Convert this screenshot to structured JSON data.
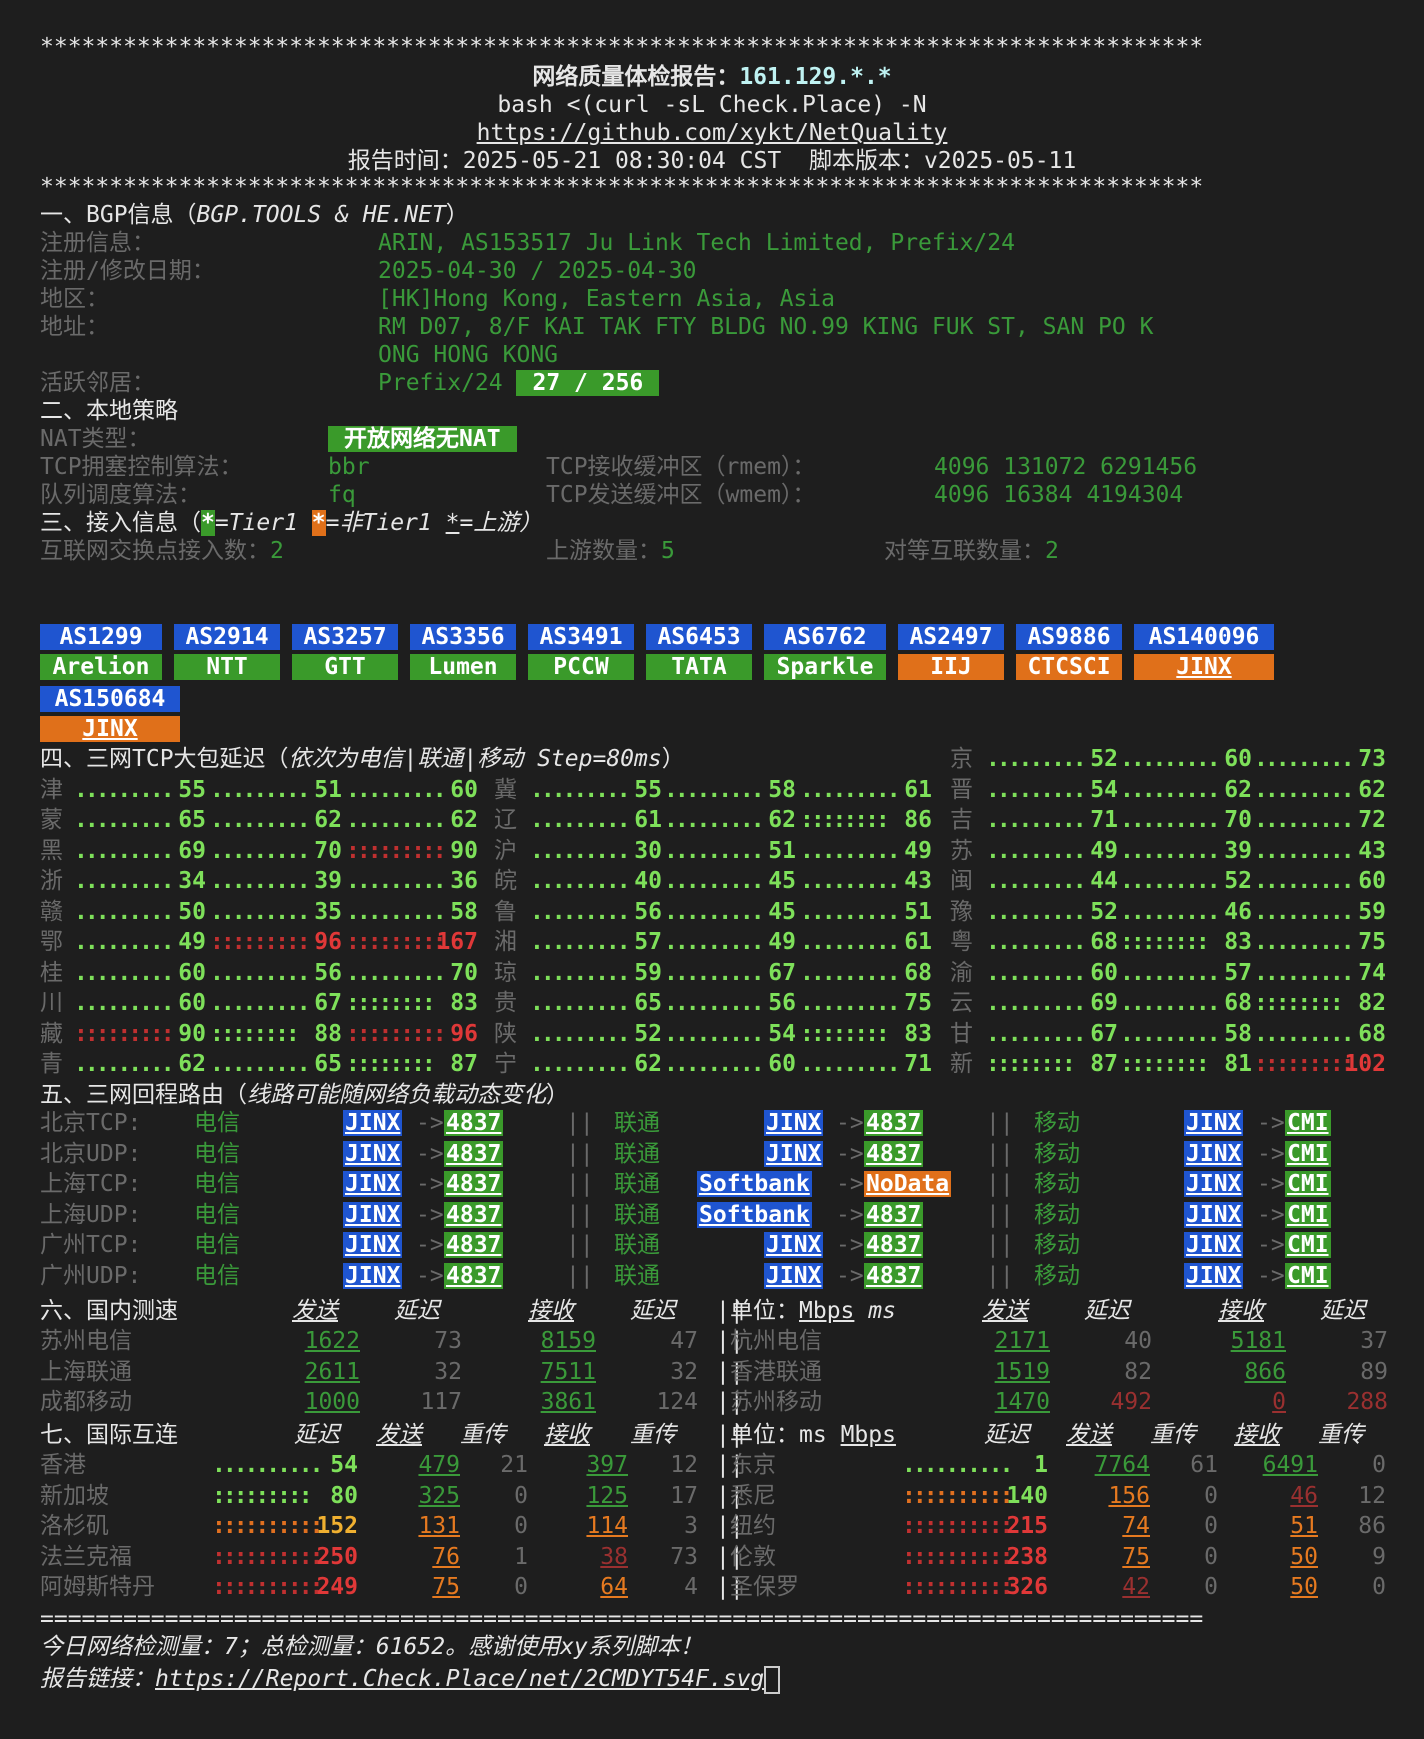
{
  "header": {
    "stars": "************************************************************************************",
    "title_cn": "网络质量体检报告：",
    "ip": "161.129.*.*",
    "cmd": "bash <(curl -sL Check.Place) -N",
    "repo": "https://github.com/xykt/NetQuality",
    "time_label": "报告时间：",
    "time": "2025-05-21 08:30:04 CST",
    "ver_label": "脚本版本：",
    "ver": "v2025-05-11"
  },
  "bgp": {
    "heading": "一、BGP信息（",
    "heading_src": "BGP.TOOLS & HE.NET",
    "heading_end": "）",
    "reg_label": "注册信息：",
    "reg": "ARIN, AS153517 Ju Link Tech Limited, Prefix/24",
    "date_label": "注册/修改日期：",
    "date": "2025-04-30 / 2025-04-30",
    "region_label": "地区：",
    "region": "[HK]Hong Kong, Eastern Asia, Asia",
    "addr_label": "地址：",
    "addr1": "RM D07, 8/F KAI TAK FTY BLDG NO.99 KING FUK ST, SAN PO K",
    "addr2": "ONG HONG KONG",
    "neigh_label": "活跃邻居：",
    "neigh_prefix": "Prefix/24",
    "neigh_val": "27 / 256"
  },
  "policy": {
    "heading": "二、本地策略",
    "nat_label": "NAT类型：",
    "nat": "开放网络无NAT",
    "cc_label": "TCP拥塞控制算法：",
    "cc": "bbr",
    "rmem_label": "TCP接收缓冲区（rmem）：",
    "rmem": "4096 131072 6291456",
    "q_label": "队列调度算法：",
    "q": "fq",
    "wmem_label": "TCP发送缓冲区（wmem）：",
    "wmem": "4096 16384 4194304"
  },
  "access": {
    "heading": "三、接入信息（",
    "t1": "*",
    "t1_txt": "=Tier1 ",
    "t2": "*",
    "t2_txt": "=非Tier1 ",
    "t3": "*",
    "t3_txt": "=上游）",
    "ix_label": "互联网交换点接入数：",
    "ix": "2",
    "up_label": "上游数量：",
    "up": "5",
    "peer_label": "对等互联数量：",
    "peer": "2",
    "asns": [
      {
        "as": "AS1299",
        "name": "Arelion"
      },
      {
        "as": "AS2914",
        "name": "NTT"
      },
      {
        "as": "AS3257",
        "name": "GTT"
      },
      {
        "as": "AS3356",
        "name": "Lumen"
      },
      {
        "as": "AS3491",
        "name": "PCCW"
      },
      {
        "as": "AS6453",
        "name": "TATA"
      },
      {
        "as": "AS6762",
        "name": "Sparkle"
      },
      {
        "as": "AS2497",
        "name": "IIJ"
      },
      {
        "as": "AS9886",
        "name": "CTCSCI"
      },
      {
        "as": "AS140096",
        "name": "JINX"
      },
      {
        "as": "AS150684",
        "name": "JINX"
      }
    ]
  },
  "latency": {
    "heading": "四、三网TCP大包延迟（",
    "heading_i": "依次为电信|联通|移动 Step=80ms",
    "heading_end": "）",
    "rows": [
      [
        "",
        "",
        "",
        "",
        "",
        "",
        "",
        "",
        "",
        "京",
        "52",
        "60",
        "73"
      ],
      [
        "津",
        "55",
        "51",
        "60",
        "冀",
        "55",
        "58",
        "61",
        "",
        "晋",
        "54",
        "62",
        "62"
      ],
      [
        "蒙",
        "65",
        "62",
        "62",
        "辽",
        "61",
        "62",
        "86",
        "",
        "吉",
        "71",
        "70",
        "72"
      ],
      [
        "黑",
        "69",
        "70",
        "90",
        "沪",
        "30",
        "51",
        "49",
        "",
        "苏",
        "49",
        "39",
        "43"
      ],
      [
        "浙",
        "34",
        "39",
        "36",
        "皖",
        "40",
        "45",
        "43",
        "",
        "闽",
        "44",
        "52",
        "60"
      ],
      [
        "赣",
        "50",
        "35",
        "58",
        "鲁",
        "56",
        "45",
        "51",
        "",
        "豫",
        "52",
        "46",
        "59"
      ],
      [
        "鄂",
        "49",
        "96",
        "167",
        "湘",
        "57",
        "49",
        "61",
        "",
        "粤",
        "68",
        "83",
        "75"
      ],
      [
        "桂",
        "60",
        "56",
        "70",
        "琼",
        "59",
        "67",
        "68",
        "",
        "渝",
        "60",
        "57",
        "74"
      ],
      [
        "川",
        "60",
        "67",
        "83",
        "贵",
        "65",
        "56",
        "75",
        "",
        "云",
        "69",
        "68",
        "82"
      ],
      [
        "藏",
        "90",
        "88",
        "96",
        "陕",
        "52",
        "54",
        "83",
        "",
        "甘",
        "67",
        "58",
        "68"
      ],
      [
        "青",
        "62",
        "65",
        "87",
        "宁",
        "62",
        "60",
        "71",
        "",
        "新",
        "87",
        "81",
        "102"
      ]
    ]
  },
  "route": {
    "heading": "五、三网回程路由（",
    "heading_i": "线路可能随网络负载动态变化",
    "heading_end": "）",
    "ct": "电信",
    "cu": "联通",
    "cm": "移动",
    "sep": "||",
    "arrow": "->",
    "rows": [
      {
        "label": "北京TCP:",
        "a1": "JINX",
        "b1": "4837",
        "a2": "JINX",
        "b2": "4837",
        "a3": "JINX",
        "b3": "CMI"
      },
      {
        "label": "北京UDP:",
        "a1": "JINX",
        "b1": "4837",
        "a2": "JINX",
        "b2": "4837",
        "a3": "JINX",
        "b3": "CMI"
      },
      {
        "label": "上海TCP:",
        "a1": "JINX",
        "b1": "4837",
        "a2": "Softbank",
        "b2": "NoData",
        "a3": "JINX",
        "b3": "CMI"
      },
      {
        "label": "上海UDP:",
        "a1": "JINX",
        "b1": "4837",
        "a2": "Softbank",
        "b2": "4837",
        "a3": "JINX",
        "b3": "CMI"
      },
      {
        "label": "广州TCP:",
        "a1": "JINX",
        "b1": "4837",
        "a2": "JINX",
        "b2": "4837",
        "a3": "JINX",
        "b3": "CMI"
      },
      {
        "label": "广州UDP:",
        "a1": "JINX",
        "b1": "4837",
        "a2": "JINX",
        "b2": "4837",
        "a3": "JINX",
        "b3": "CMI"
      }
    ]
  },
  "domestic": {
    "heading": "六、国内测速",
    "send": "发送",
    "lat": "延迟",
    "recv": "接收",
    "unit_label": "单位：",
    "unit1": "Mbps",
    "unit2": "ms",
    "rows": [
      {
        "l": "苏州电信",
        "s": "1622",
        "sl": "73",
        "r": "8159",
        "rl": "47",
        "l2": "杭州电信",
        "s2": "2171",
        "sl2": "40",
        "r2": "5181",
        "rl2": "37"
      },
      {
        "l": "上海联通",
        "s": "2611",
        "sl": "32",
        "r": "7511",
        "rl": "32",
        "l2": "香港联通",
        "s2": "1519",
        "sl2": "82",
        "r2": "866",
        "rl2": "89"
      },
      {
        "l": "成都移动",
        "s": "1000",
        "sl": "117",
        "r": "3861",
        "rl": "124",
        "l2": "苏州移动",
        "s2": "1470",
        "sl2": "492",
        "r2": "0",
        "rl2": "288"
      }
    ]
  },
  "intl": {
    "heading": "七、国际互连",
    "lat": "延迟",
    "send": "发送",
    "retr": "重传",
    "recv": "接收",
    "unit_label": "单位：",
    "unit1": "ms",
    "unit2": "Mbps",
    "rows": [
      {
        "l": "香港",
        "lat": "54",
        "s": "479",
        "sr": "21",
        "r": "397",
        "rr": "12",
        "l2": "东京",
        "lat2": "1",
        "s2": "7764",
        "sr2": "61",
        "r2": "6491",
        "rr2": "0"
      },
      {
        "l": "新加坡",
        "lat": "80",
        "s": "325",
        "sr": "0",
        "r": "125",
        "rr": "17",
        "l2": "悉尼",
        "lat2": "140",
        "s2": "156",
        "sr2": "0",
        "r2": "46",
        "rr2": "12"
      },
      {
        "l": "洛杉矶",
        "lat": "152",
        "s": "131",
        "sr": "0",
        "r": "114",
        "rr": "3",
        "l2": "纽约",
        "lat2": "215",
        "s2": "74",
        "sr2": "0",
        "r2": "51",
        "rr2": "86"
      },
      {
        "l": "法兰克福",
        "lat": "250",
        "s": "76",
        "sr": "1",
        "r": "38",
        "rr": "73",
        "l2": "伦敦",
        "lat2": "238",
        "s2": "75",
        "sr2": "0",
        "r2": "50",
        "rr2": "9"
      },
      {
        "l": "阿姆斯特丹",
        "lat": "249",
        "s": "75",
        "sr": "0",
        "r": "64",
        "rr": "4",
        "l2": "圣保罗",
        "lat2": "326",
        "s2": "42",
        "sr2": "0",
        "r2": "50",
        "rr2": "0"
      }
    ]
  },
  "footer": {
    "rule": "====================================================================================",
    "count": "今日网络检测量：7；总检测量：61652。感谢使用xy系列脚本！",
    "link_label": "报告链接：",
    "link": "https://Report.Check.Place/net/2CMDYT54F.svg"
  }
}
